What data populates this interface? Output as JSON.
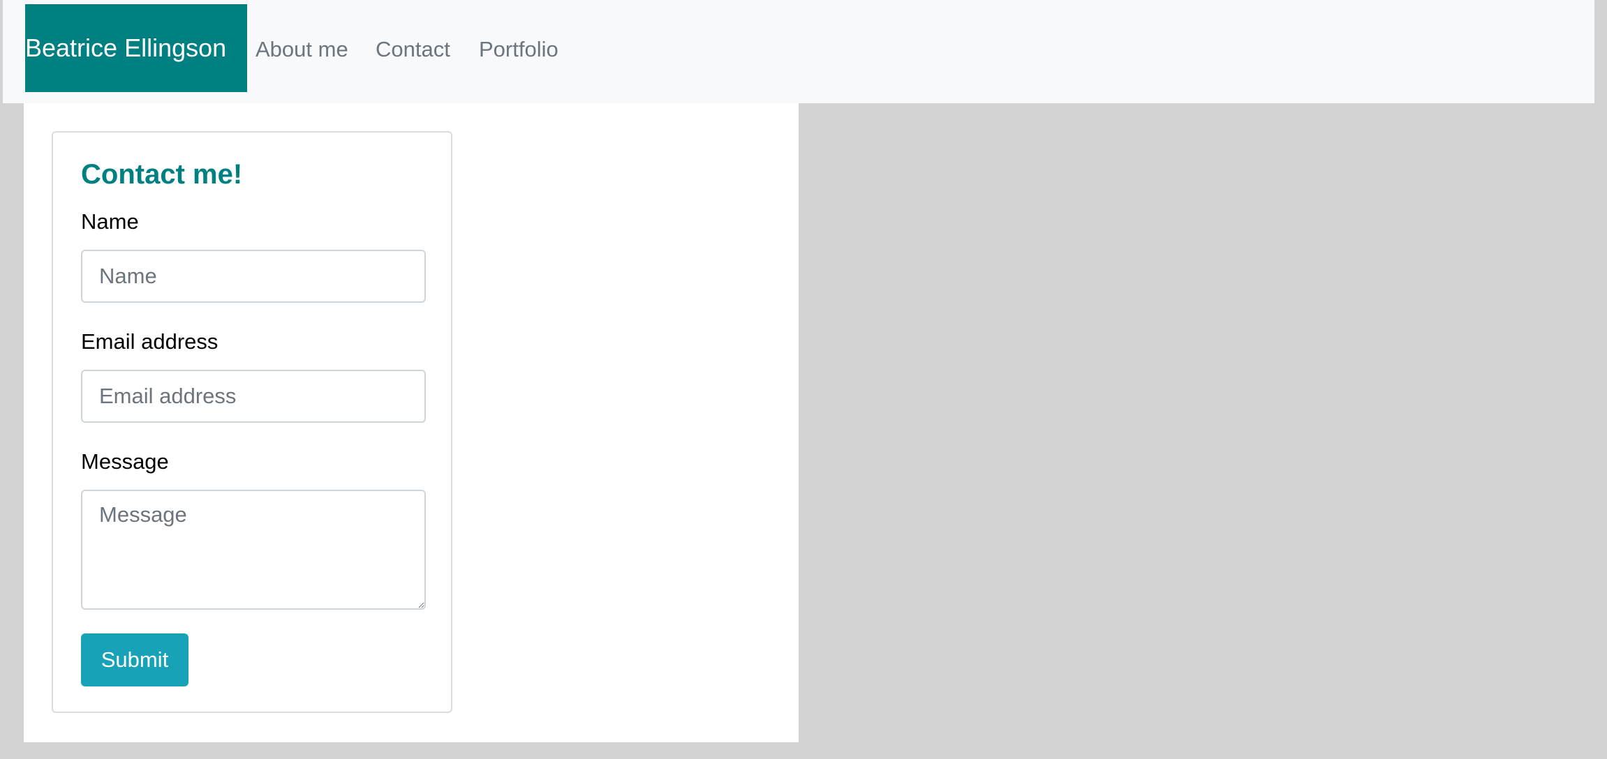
{
  "navbar": {
    "brand": "Beatrice Ellingson",
    "links": [
      {
        "label": "About me"
      },
      {
        "label": "Contact"
      },
      {
        "label": "Portfolio"
      }
    ]
  },
  "contact_form": {
    "title": "Contact me!",
    "name": {
      "label": "Name",
      "placeholder": "Name",
      "value": ""
    },
    "email": {
      "label": "Email address",
      "placeholder": "Email address",
      "value": ""
    },
    "message": {
      "label": "Message",
      "placeholder": "Message",
      "value": ""
    },
    "submit_label": "Submit"
  },
  "colors": {
    "brand_bg": "#008080",
    "title": "#008080",
    "submit_bg": "#17a2b8",
    "navbar_bg": "#f8f9fa",
    "page_bg": "#d3d3d3"
  }
}
